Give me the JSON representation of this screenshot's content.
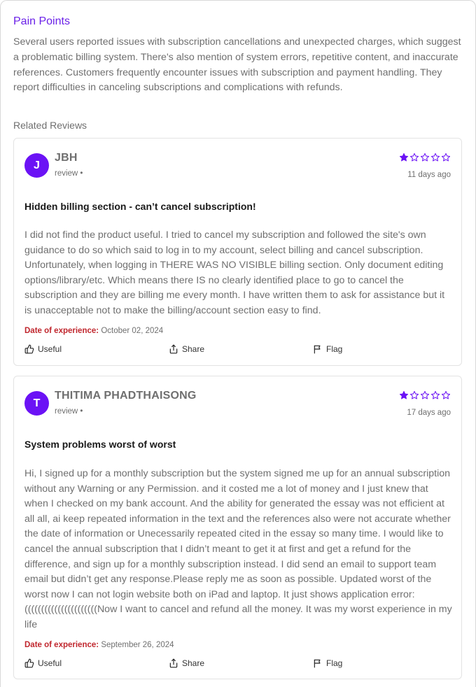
{
  "pain_points": {
    "title": "Pain Points",
    "text": "Several users reported issues with subscription cancellations and unexpected charges, which suggest a problematic billing system. There's also mention of system errors, repetitive content, and inaccurate references. Customers frequently encounter issues with subscription and payment handling. They report difficulties in canceling subscriptions and complications with refunds."
  },
  "related_reviews": {
    "heading": "Related Reviews",
    "reviews": [
      {
        "initial": "J",
        "name": "JBH",
        "type": "review •",
        "rating": 1,
        "rating_max": 5,
        "age": "11 days ago",
        "title": "Hidden billing section - can’t cancel subscription!",
        "body": "I did not find the product useful. I tried to cancel my subscription and followed the site's own guidance to do so which said to log in to my account, select billing and cancel subscription. Unfortunately, when logging in THERE WAS NO VISIBLE billing section. Only document editing options/library/etc. Which means there IS no clearly identified place to go to cancel the subscription and they are billing me every month. I have written them to ask for assistance but it is unacceptable not to make the billing/account section easy to find.",
        "date_label": "Date of experience:",
        "date": "October 02, 2024",
        "useful": "Useful",
        "share": "Share",
        "flag": "Flag"
      },
      {
        "initial": "T",
        "name": "THITIMA PHADTHAISONG",
        "type": "review •",
        "rating": 1,
        "rating_max": 5,
        "age": "17 days ago",
        "title": "System problems worst of worst",
        "body": "Hi, I signed up for a monthly subscription but the system signed me up for an annual subscription without any Warning or any Permission. and it costed me a lot of money and I just knew that when I checked on my bank account. And the ability for generated the essay was not efficient at all all, ai keep repeated information in the text and the references also were not accurate whether the date of information or Unecessarily repeated cited in the essay so many time. I would like to cancel the annual subscription that I didn’t meant to get it at first and get a refund for the difference, and sign up for a monthly subscription instead. I did send an email to support team email but didn’t get any response.Please reply me as soon as possible. Updated worst of the worst now I can not login website both on iPad and laptop. It just shows application error:((((((((((((((((((((((Now I want to cancel and refund all the money. It was my worst experience in my life",
        "date_label": "Date of experience:",
        "date": "September 26, 2024",
        "useful": "Useful",
        "share": "Share",
        "flag": "Flag"
      }
    ]
  },
  "colors": {
    "accent": "#6b21e8",
    "avatar_bg": "#6b12f5",
    "star": "#6b12f5",
    "date_label": "#c0262d",
    "muted_text": "#6f6f6f"
  },
  "icons": [
    "star-filled-icon",
    "star-outline-icon",
    "thumbs-up-icon",
    "share-icon",
    "flag-icon"
  ]
}
